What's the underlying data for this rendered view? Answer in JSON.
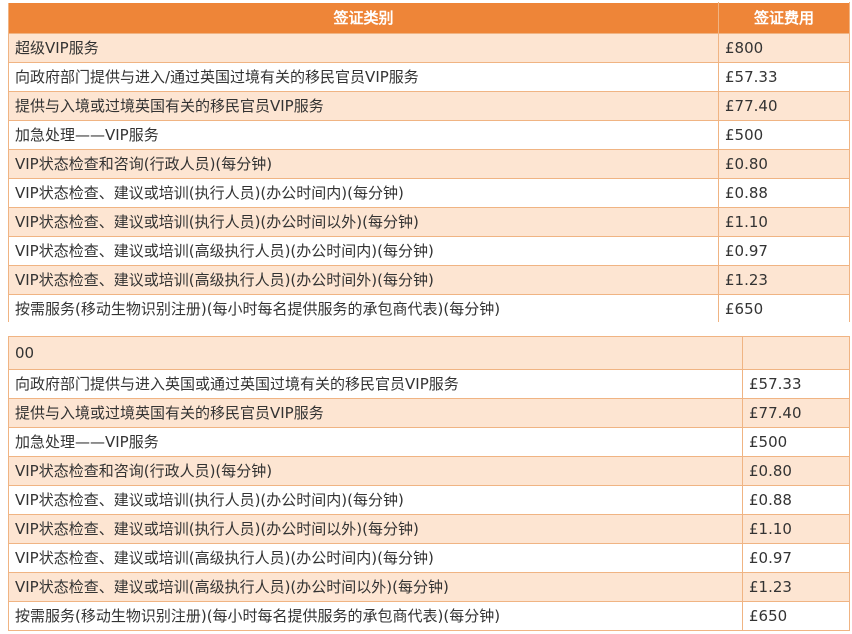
{
  "table1": {
    "headers": [
      "签证类别",
      "签证费用"
    ],
    "rows": [
      {
        "label": "超级VIP服务",
        "fee": "£800"
      },
      {
        "label": "向政府部门提供与进入/通过英国过境有关的移民官员VIP服务",
        "fee": "£57.33"
      },
      {
        "label": "提供与入境或过境英国有关的移民官员VIP服务",
        "fee": "£77.40"
      },
      {
        "label": "加急处理——VIP服务",
        "fee": "£500"
      },
      {
        "label": "VIP状态检查和咨询(行政人员)(每分钟)",
        "fee": "£0.80"
      },
      {
        "label": "VIP状态检查、建议或培训(执行人员)(办公时间内)(每分钟)",
        "fee": "£0.88"
      },
      {
        "label": "VIP状态检查、建议或培训(执行人员)(办公时间以外)(每分钟)",
        "fee": "£1.10"
      },
      {
        "label": "VIP状态检查、建议或培训(高级执行人员)(办公时间内)(每分钟)",
        "fee": "£0.97"
      },
      {
        "label": "VIP状态检查、建议或培训(高级执行人员)(办公时间外)(每分钟)",
        "fee": "£1.23"
      },
      {
        "label": "按需服务(移动生物识别注册)(每小时每名提供服务的承包商代表)(每分钟)",
        "fee": "£650"
      }
    ]
  },
  "table2": {
    "header_label": "00",
    "header_fee": "",
    "rows": [
      {
        "label": "向政府部门提供与进入英国或通过英国过境有关的移民官员VIP服务",
        "fee": "£57.33"
      },
      {
        "label": "提供与入境或过境英国有关的移民官员VIP服务",
        "fee": "£77.40"
      },
      {
        "label": "加急处理——VIP服务",
        "fee": "£500"
      },
      {
        "label": "VIP状态检查和咨询(行政人员)(每分钟)",
        "fee": "£0.80"
      },
      {
        "label": "VIP状态检查、建议或培训(执行人员)(办公时间内)(每分钟)",
        "fee": "£0.88"
      },
      {
        "label": "VIP状态检查、建议或培训(执行人员)(办公时间以外)(每分钟)",
        "fee": "£1.10"
      },
      {
        "label": "VIP状态检查、建议或培训(高级执行人员)(办公时间内)(每分钟)",
        "fee": "£0.97"
      },
      {
        "label": "VIP状态检查、建议或培训(高级执行人员)(办公时间以外)(每分钟)",
        "fee": "£1.23"
      },
      {
        "label": "按需服务(移动生物识别注册)(每小时每名提供服务的承包商代表)(每分钟)",
        "fee": "£650"
      }
    ]
  },
  "colors": {
    "header_bg": "#ee8538",
    "header_text": "#ffffff",
    "shaded_row": "#fde5d2",
    "border": "#f0b483",
    "text": "#333333"
  }
}
